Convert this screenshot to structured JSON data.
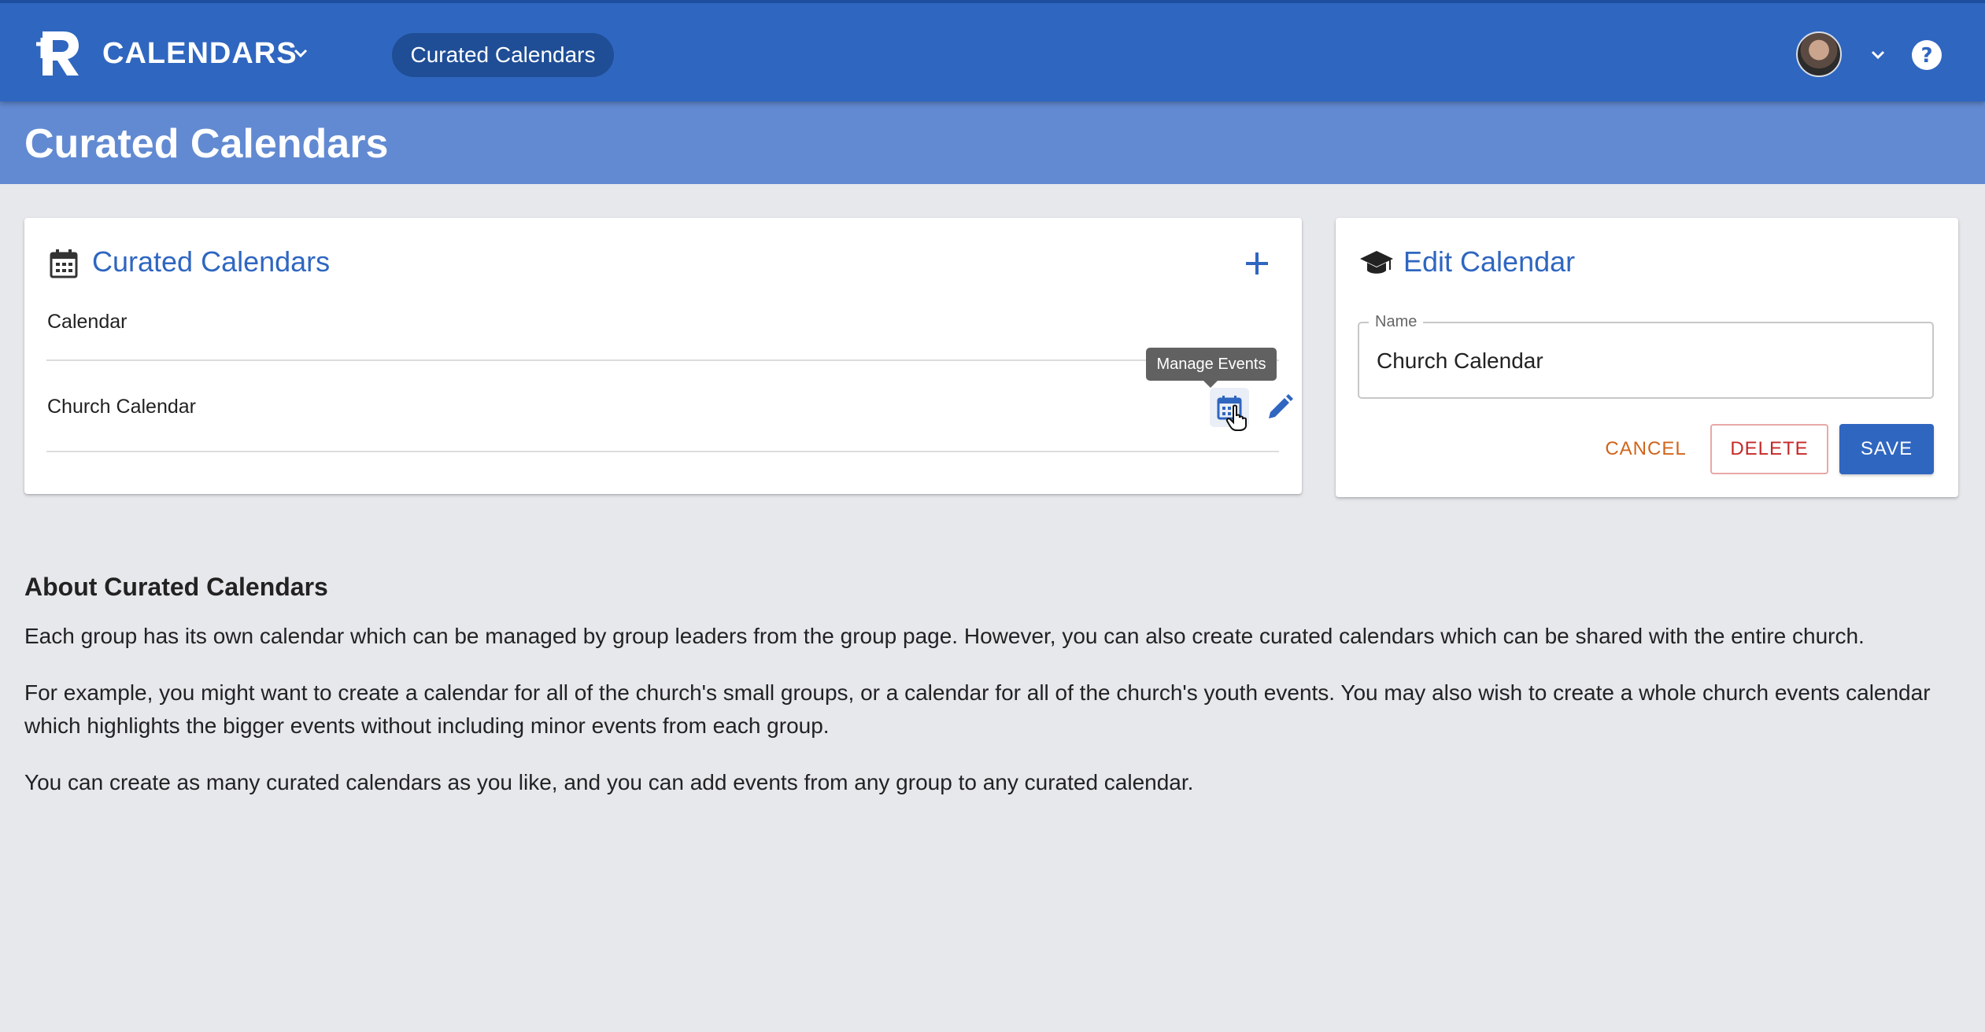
{
  "topbar": {
    "app_title": "CALENDARS",
    "nav_pill": "Curated Calendars",
    "help_symbol": "?"
  },
  "page": {
    "title": "Curated Calendars"
  },
  "calendars_card": {
    "title": "Curated Calendars",
    "rows": [
      {
        "label": "Calendar"
      },
      {
        "label": "Church Calendar"
      }
    ],
    "tooltip": "Manage Events"
  },
  "edit_card": {
    "title": "Edit Calendar",
    "name_label": "Name",
    "name_value": "Church Calendar",
    "cancel_label": "CANCEL",
    "delete_label": "DELETE",
    "save_label": "SAVE"
  },
  "about": {
    "heading": "About Curated Calendars",
    "paragraphs": [
      "Each group has its own calendar which can be managed by group leaders from the group page. However, you can also create curated calendars which can be shared with the entire church.",
      "For example, you might want to create a calendar for all of the church's small groups, or a calendar for all of the church's youth events. You may also wish to create a whole church events calendar which highlights the bigger events without including minor events from each group.",
      "You can create as many curated calendars as you like, and you can add events from any group to any curated calendar."
    ]
  },
  "colors": {
    "topbar": "#2f66c0",
    "header_band": "#628ad2",
    "accent": "#2f66c0",
    "cancel": "#d0651b",
    "delete": "#c62828",
    "background": "#e6e8ec"
  },
  "icons": [
    "app-logo-icon",
    "chevron-down-icon",
    "help-icon",
    "calendar-icon",
    "plus-icon",
    "manage-events-icon",
    "edit-pencil-icon",
    "graduation-cap-icon",
    "hand-cursor-icon"
  ]
}
